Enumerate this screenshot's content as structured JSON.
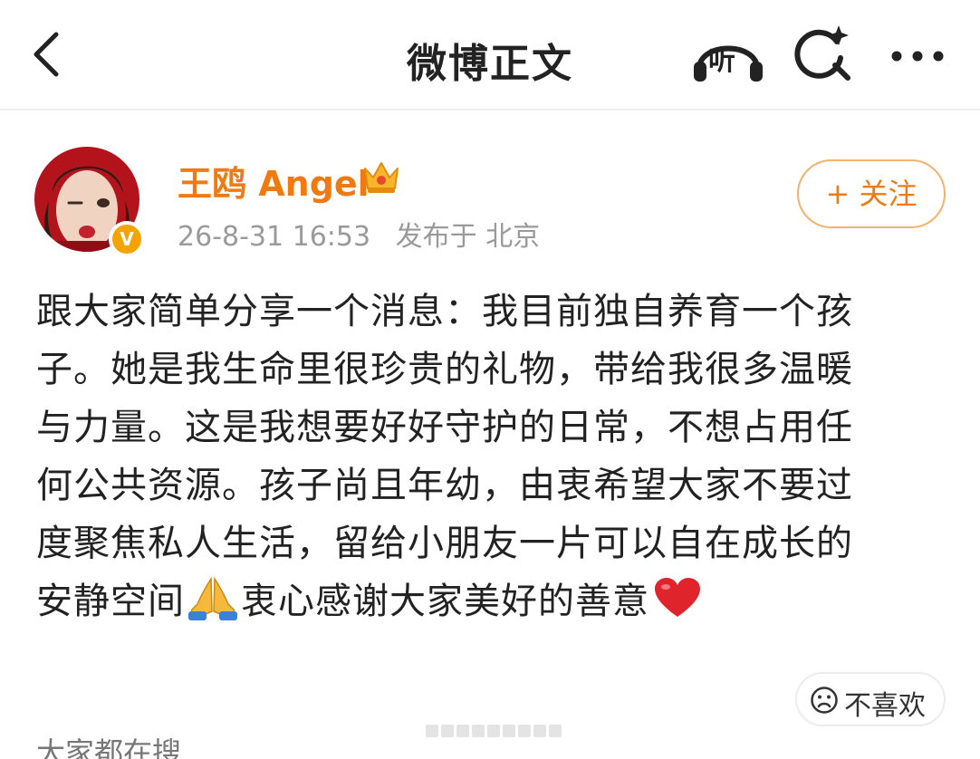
{
  "header": {
    "title": "微博正文",
    "listen_label": "听"
  },
  "author": {
    "name": "王鸥 Angel",
    "verified_badge": "V",
    "timestamp": "26-8-31 16:53",
    "location": "发布于 北京"
  },
  "follow": {
    "label": "+ 关注"
  },
  "post": {
    "lines": [
      "跟大家简单分享一个消息：我目前独自养育一个孩",
      "子。她是我生命里很珍贵的礼物，带给我很多温暖",
      "与力量。这是我想要好好守护的日常，不想占用任",
      "何公共资源。孩子尚且年幼，由衷希望大家不要过",
      "度聚焦私人生活，留给小朋友一片可以自在成长的"
    ],
    "last_line_before_emoji": "安静空间",
    "last_line_after_emoji": "衷心感谢大家美好的善意"
  },
  "dislike": {
    "label": "不喜欢"
  },
  "trending": {
    "label": "大家都在搜"
  },
  "colors": {
    "accent": "#f07a12",
    "meta_gray": "#9a9a9a",
    "badge": "#f4a300"
  },
  "icons": [
    "back-arrow-icon",
    "headphones-icon",
    "search-sparkle-icon",
    "more-dots-icon",
    "crown-icon",
    "pray-emoji-icon",
    "heart-emoji-icon",
    "sad-face-icon"
  ]
}
